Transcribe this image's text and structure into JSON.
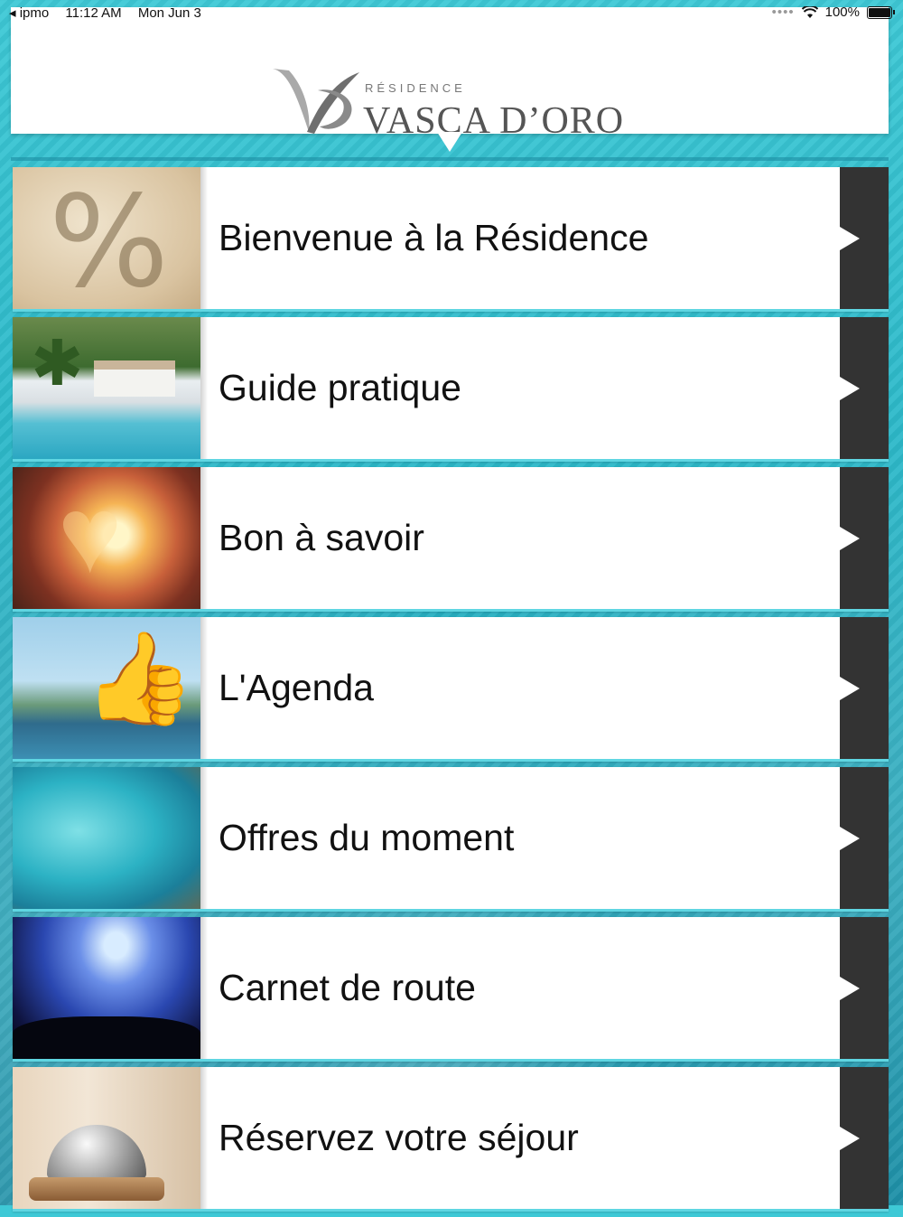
{
  "status_bar": {
    "carrier": "◂ ipmo",
    "time": "11:12 AM",
    "date": "Mon Jun 3",
    "battery": "100%"
  },
  "header": {
    "logo_subtitle": "RÉSIDENCE",
    "logo_title": "VASCA D’ORO"
  },
  "menu": {
    "items": [
      {
        "label": "Bienvenue à la Résidence",
        "thumbnail": "percent-in-sand"
      },
      {
        "label": "Guide pratique",
        "thumbnail": "pool-garden"
      },
      {
        "label": "Bon à savoir",
        "thumbnail": "heart-hands-sunset"
      },
      {
        "label": "L'Agenda",
        "thumbnail": "thumbs-up-beach"
      },
      {
        "label": "Offres du moment",
        "thumbnail": "turquoise-cove"
      },
      {
        "label": "Carnet de route",
        "thumbnail": "concert-lights"
      },
      {
        "label": "Réservez votre séjour",
        "thumbnail": "service-bell"
      }
    ]
  },
  "colors": {
    "accent": "#3ec9d6",
    "arrow_box": "#333333"
  }
}
